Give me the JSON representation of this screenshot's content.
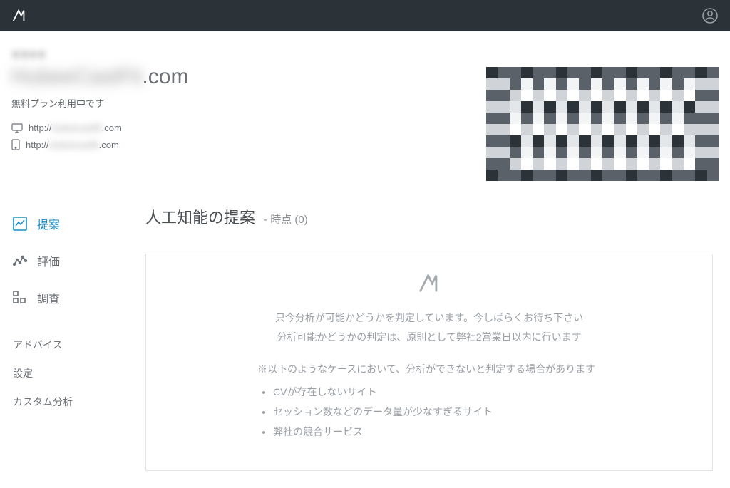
{
  "header": {
    "account_label_blur": "管理者様",
    "domain_blur_part": "HubeeCastFit",
    "domain_suffix": ".com",
    "plan_status": "無料プラン利用中です",
    "desktop_url_prefix": "http://",
    "desktop_url_blur": "hubeecastfit",
    "desktop_url_suffix": ".com",
    "mobile_url_prefix": "http://",
    "mobile_url_blur": "hubeecastfit",
    "mobile_url_suffix": ".com"
  },
  "sidebar": {
    "primary": [
      {
        "label": "提案",
        "icon": "chart-line-icon"
      },
      {
        "label": "評価",
        "icon": "trend-icon"
      },
      {
        "label": "調査",
        "icon": "grid-icon"
      }
    ],
    "secondary": [
      {
        "label": "アドバイス"
      },
      {
        "label": "設定"
      },
      {
        "label": "カスタム分析"
      }
    ]
  },
  "content": {
    "page_title": "人工知能の提案",
    "page_sub_dash": "- ",
    "page_sub_time": "時点 (0)",
    "analysis_line1": "只今分析が可能かどうかを判定しています。今しばらくお待ち下さい",
    "analysis_line2": "分析可能かどうかの判定は、原則として弊社2営業日以内に行います",
    "note_heading": "※以下のようなケースにおいて、分析ができないと判定する場合があります",
    "note_items": [
      "CVが存在しないサイト",
      "セッション数などのデータ量が少なすぎるサイト",
      "弊社の競合サービス"
    ]
  }
}
